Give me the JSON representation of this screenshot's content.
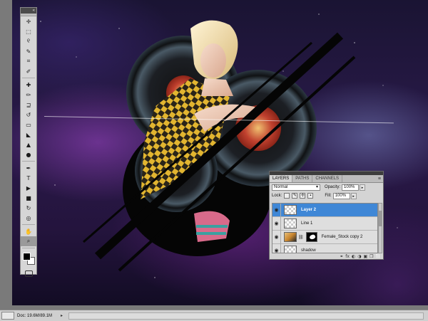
{
  "status": {
    "doc_size": "Doc: 19.6M/89.1M",
    "arrow": "▸"
  },
  "tools": {
    "collapse_label": "«",
    "items": [
      {
        "name": "move-tool-icon",
        "glyph": "✛"
      },
      {
        "name": "marquee-tool-icon",
        "glyph": "⬚"
      },
      {
        "name": "lasso-tool-icon",
        "glyph": "୧"
      },
      {
        "name": "quick-selection-tool-icon",
        "glyph": "✎"
      },
      {
        "name": "crop-tool-icon",
        "glyph": "⌗"
      },
      {
        "name": "eyedropper-tool-icon",
        "glyph": "✐"
      },
      {
        "name": "healing-brush-tool-icon",
        "glyph": "✚"
      },
      {
        "name": "brush-tool-icon",
        "glyph": "✏"
      },
      {
        "name": "clone-stamp-tool-icon",
        "glyph": "⊒"
      },
      {
        "name": "history-brush-tool-icon",
        "glyph": "↺"
      },
      {
        "name": "eraser-tool-icon",
        "glyph": "▭"
      },
      {
        "name": "paint-bucket-tool-icon",
        "glyph": "◣"
      },
      {
        "name": "blur-tool-icon",
        "glyph": "▲"
      },
      {
        "name": "dodge-tool-icon",
        "glyph": "●"
      },
      {
        "name": "pen-tool-icon",
        "glyph": "✒"
      },
      {
        "name": "type-tool-icon",
        "glyph": "T"
      },
      {
        "name": "path-selection-tool-icon",
        "glyph": "▶"
      },
      {
        "name": "shape-tool-icon",
        "glyph": "■"
      },
      {
        "name": "3d-rotate-tool-icon",
        "glyph": "↻"
      },
      {
        "name": "3d-orbit-tool-icon",
        "glyph": "◎"
      },
      {
        "name": "hand-tool-icon",
        "glyph": "✋"
      },
      {
        "name": "zoom-tool-icon",
        "glyph": "⌕"
      }
    ],
    "active_index": 21
  },
  "layers_panel": {
    "tabs": [
      "LAYERS",
      "PATHS",
      "CHANNELS"
    ],
    "active_tab": "LAYERS",
    "menu_glyph": "≡",
    "blend_mode": "Normal",
    "opacity_label": "Opacity:",
    "opacity_value": "100%",
    "lock_label": "Lock:",
    "fill_label": "Fill:",
    "fill_value": "100%",
    "layers": [
      {
        "name": "Layer 2",
        "selected": true,
        "thumb": "transparent"
      },
      {
        "name": "Line 1",
        "selected": false,
        "thumb": "transparent"
      },
      {
        "name": "Female_Stock copy 2",
        "selected": false,
        "thumb": "photo",
        "mask": true
      },
      {
        "name": "shadow",
        "selected": false,
        "thumb": "transparent"
      }
    ],
    "eye_glyph": "◉",
    "footer_glyphs": [
      "⚭",
      "fx",
      "◐",
      "◑",
      "▣",
      "❐",
      "⬜"
    ]
  },
  "colors": {
    "selection_blue": "#3f87d6",
    "panel_bg": "#d4d4d4"
  }
}
